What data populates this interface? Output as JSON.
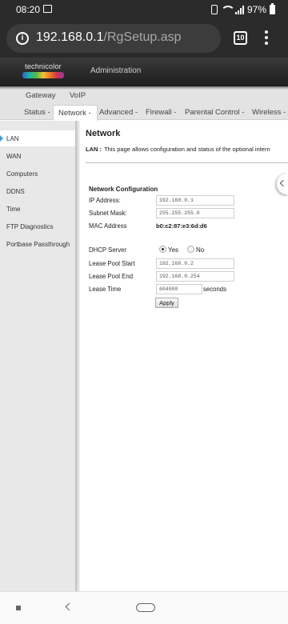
{
  "statusbar": {
    "time": "08:20",
    "battery": "97%"
  },
  "browser": {
    "url_host": "192.168.0.1",
    "url_path": "/RgSetup.asp",
    "tab_count": "10"
  },
  "header": {
    "brand": "technicolor",
    "title": "Administration"
  },
  "menu_primary": [
    "Gateway",
    "VoIP"
  ],
  "menu_secondary": [
    "Status -",
    "Network -",
    "Advanced -",
    "Firewall -",
    "Parental Control -",
    "Wireless -"
  ],
  "sidebar": {
    "items": [
      {
        "label": "LAN",
        "active": true
      },
      {
        "label": "WAN"
      },
      {
        "label": "Computers"
      },
      {
        "label": "DDNS"
      },
      {
        "label": "Time"
      },
      {
        "label": "FTP Diagnostics"
      },
      {
        "label": "Portbase Passthrough"
      }
    ]
  },
  "content": {
    "title": "Network",
    "desc_label": "LAN :",
    "desc_text": "This page allows configuration and status of the optional intern",
    "section_title": "Network Configuration",
    "ip_label": "IP Address:",
    "ip_value": "192.168.0.1",
    "subnet_label": "Subnet Mask:",
    "subnet_value": "255.255.255.0",
    "mac_label": "MAC Address",
    "mac_value": "b0:c2:87:e3:6d:d6",
    "dhcp_label": "DHCP Server",
    "dhcp_yes": "Yes",
    "dhcp_no": "No",
    "dhcp_selected": "Yes",
    "pool_start_label": "Lease Pool Start",
    "pool_start_value": "192.168.0.2",
    "pool_end_label": "Lease Pool End",
    "pool_end_value": "192.168.0.254",
    "lease_time_label": "Lease Time",
    "lease_time_value": "604800",
    "lease_time_unit": "seconds",
    "apply_label": "Apply"
  }
}
